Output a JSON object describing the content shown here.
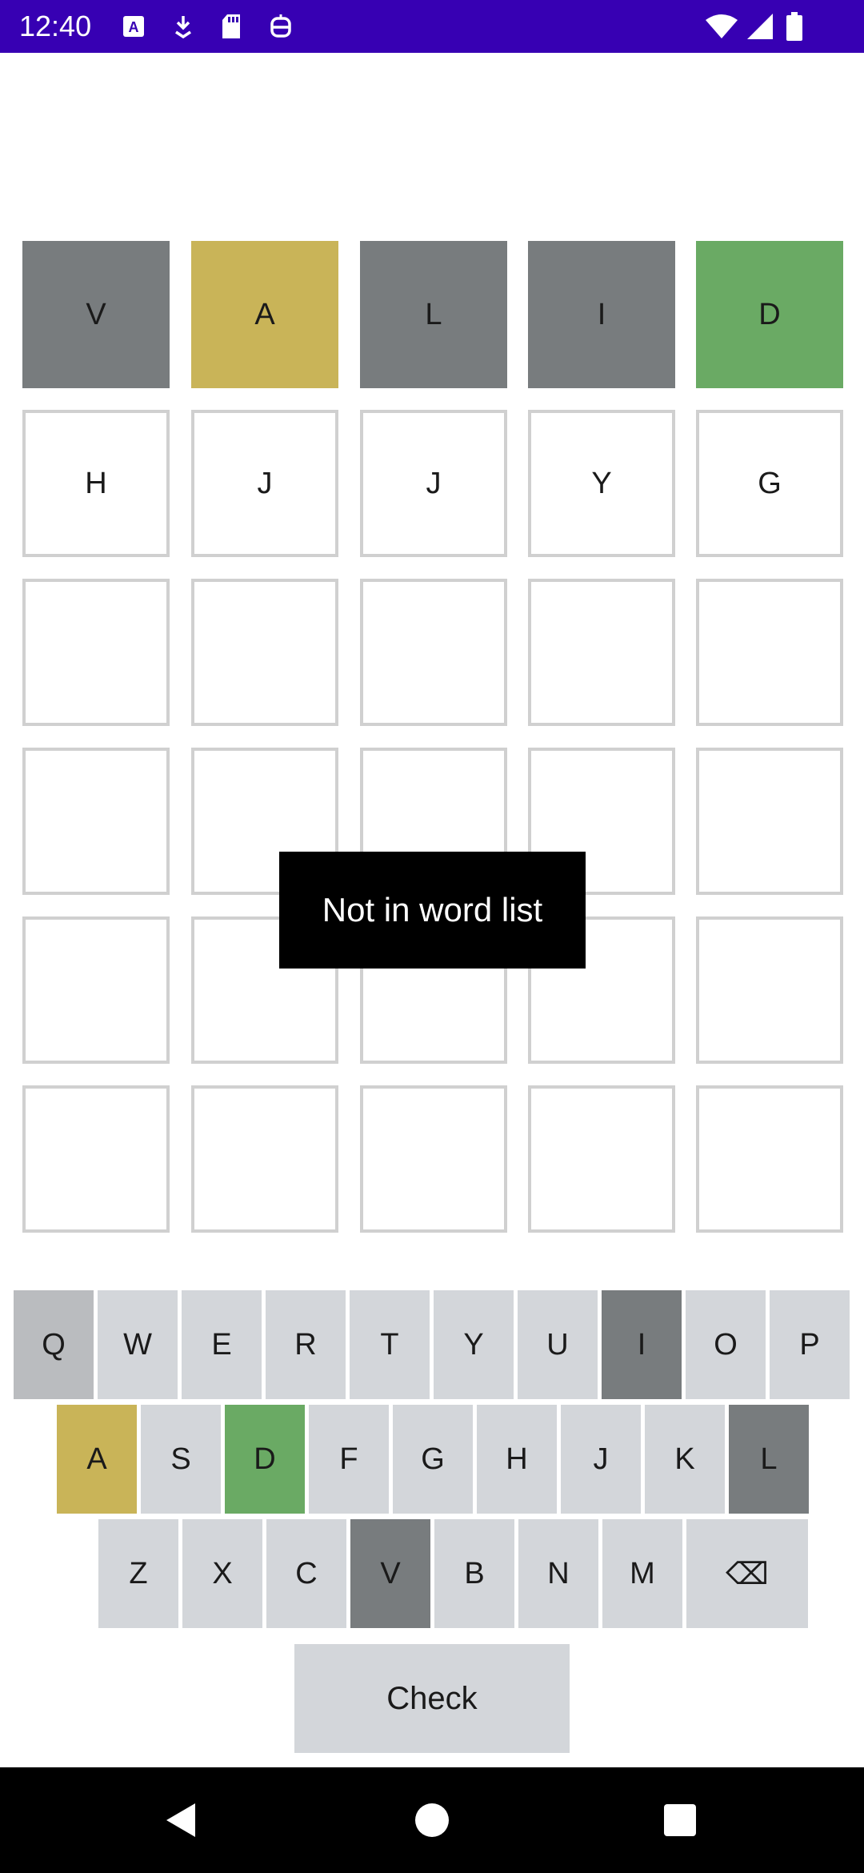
{
  "status_bar": {
    "time": "12:40",
    "left_icons": [
      "text-a-icon",
      "download-icon",
      "sd-card-icon",
      "robot-icon"
    ],
    "right_icons": [
      "wifi-icon",
      "signal-icon",
      "battery-icon"
    ]
  },
  "board": {
    "rows": [
      [
        {
          "letter": "V",
          "state": "absent"
        },
        {
          "letter": "A",
          "state": "present"
        },
        {
          "letter": "L",
          "state": "absent"
        },
        {
          "letter": "I",
          "state": "absent"
        },
        {
          "letter": "D",
          "state": "correct"
        }
      ],
      [
        {
          "letter": "H",
          "state": "empty"
        },
        {
          "letter": "J",
          "state": "empty"
        },
        {
          "letter": "J",
          "state": "empty"
        },
        {
          "letter": "Y",
          "state": "empty"
        },
        {
          "letter": "G",
          "state": "empty"
        }
      ],
      [
        {
          "letter": "",
          "state": "empty"
        },
        {
          "letter": "",
          "state": "empty"
        },
        {
          "letter": "",
          "state": "empty"
        },
        {
          "letter": "",
          "state": "empty"
        },
        {
          "letter": "",
          "state": "empty"
        }
      ],
      [
        {
          "letter": "",
          "state": "empty"
        },
        {
          "letter": "",
          "state": "empty"
        },
        {
          "letter": "",
          "state": "empty"
        },
        {
          "letter": "",
          "state": "empty"
        },
        {
          "letter": "",
          "state": "empty"
        }
      ],
      [
        {
          "letter": "",
          "state": "empty"
        },
        {
          "letter": "",
          "state": "empty"
        },
        {
          "letter": "",
          "state": "empty"
        },
        {
          "letter": "",
          "state": "empty"
        },
        {
          "letter": "",
          "state": "empty"
        }
      ],
      [
        {
          "letter": "",
          "state": "empty"
        },
        {
          "letter": "",
          "state": "empty"
        },
        {
          "letter": "",
          "state": "empty"
        },
        {
          "letter": "",
          "state": "empty"
        },
        {
          "letter": "",
          "state": "empty"
        }
      ]
    ]
  },
  "toast": {
    "message": "Not in word list"
  },
  "keyboard": {
    "rows": [
      [
        {
          "label": "Q",
          "state": "q-used"
        },
        {
          "label": "W",
          "state": "unused"
        },
        {
          "label": "E",
          "state": "unused"
        },
        {
          "label": "R",
          "state": "unused"
        },
        {
          "label": "T",
          "state": "unused"
        },
        {
          "label": "Y",
          "state": "unused"
        },
        {
          "label": "U",
          "state": "unused"
        },
        {
          "label": "I",
          "state": "absent"
        },
        {
          "label": "O",
          "state": "unused"
        },
        {
          "label": "P",
          "state": "unused"
        }
      ],
      [
        {
          "label": "A",
          "state": "present"
        },
        {
          "label": "S",
          "state": "unused"
        },
        {
          "label": "D",
          "state": "correct"
        },
        {
          "label": "F",
          "state": "unused"
        },
        {
          "label": "G",
          "state": "unused"
        },
        {
          "label": "H",
          "state": "unused"
        },
        {
          "label": "J",
          "state": "unused"
        },
        {
          "label": "K",
          "state": "unused"
        },
        {
          "label": "L",
          "state": "absent"
        }
      ],
      [
        {
          "label": "Z",
          "state": "unused"
        },
        {
          "label": "X",
          "state": "unused"
        },
        {
          "label": "C",
          "state": "unused"
        },
        {
          "label": "V",
          "state": "absent"
        },
        {
          "label": "B",
          "state": "unused"
        },
        {
          "label": "N",
          "state": "unused"
        },
        {
          "label": "M",
          "state": "unused"
        },
        {
          "label": "⌫",
          "state": "unused",
          "icon": "backspace-icon"
        }
      ]
    ],
    "check_label": "Check"
  },
  "colors": {
    "status_bar": "#3700b3",
    "absent": "#787c7e",
    "present": "#c9b458",
    "correct": "#6aaa64",
    "key_default": "#d3d6da",
    "empty_border": "#d0d0d0"
  },
  "nav_bar": {
    "buttons": [
      "back-icon",
      "home-icon",
      "recents-icon"
    ]
  }
}
